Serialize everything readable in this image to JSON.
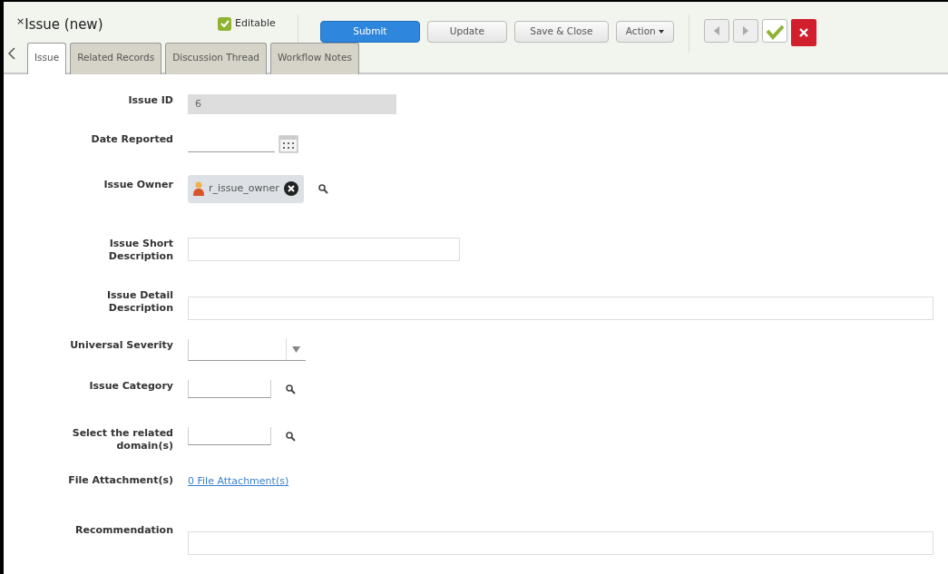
{
  "header": {
    "mark": "×",
    "title": "Issue (new)",
    "editable": {
      "label": "Editable",
      "checked": true
    }
  },
  "buttons": [
    {
      "label": "Submit",
      "kind": "primary"
    },
    {
      "label": "Update",
      "kind": "plain"
    },
    {
      "label": "Save & Close",
      "kind": "plain"
    },
    {
      "label": "Action",
      "kind": "dropdown"
    }
  ],
  "tabs": [
    {
      "label": "Issue",
      "selected": true
    },
    {
      "label": "Related Records",
      "selected": false
    },
    {
      "label": "Discussion Thread",
      "selected": false
    },
    {
      "label": "Workflow Notes",
      "selected": false
    }
  ],
  "fields": [
    {
      "label": "Issue ID",
      "kind": "readonly",
      "value": "6"
    },
    {
      "label": "Date Reported",
      "kind": "date"
    },
    {
      "label": "Issue Owner",
      "kind": "person",
      "value": "r_issue_owner"
    },
    {
      "label": "Issue Short Description",
      "kind": "text-short"
    },
    {
      "label": "Issue Detail Description",
      "kind": "text"
    },
    {
      "label": "Universal Severity",
      "kind": "select"
    },
    {
      "label": "Issue Category",
      "kind": "lookup"
    },
    {
      "label": "Select the related domain(s)",
      "kind": "lookup"
    },
    {
      "label": "File Attachment(s)",
      "kind": "link",
      "value": "0 File Attachment(s)"
    },
    {
      "label": "Recommendation",
      "kind": "text"
    }
  ]
}
